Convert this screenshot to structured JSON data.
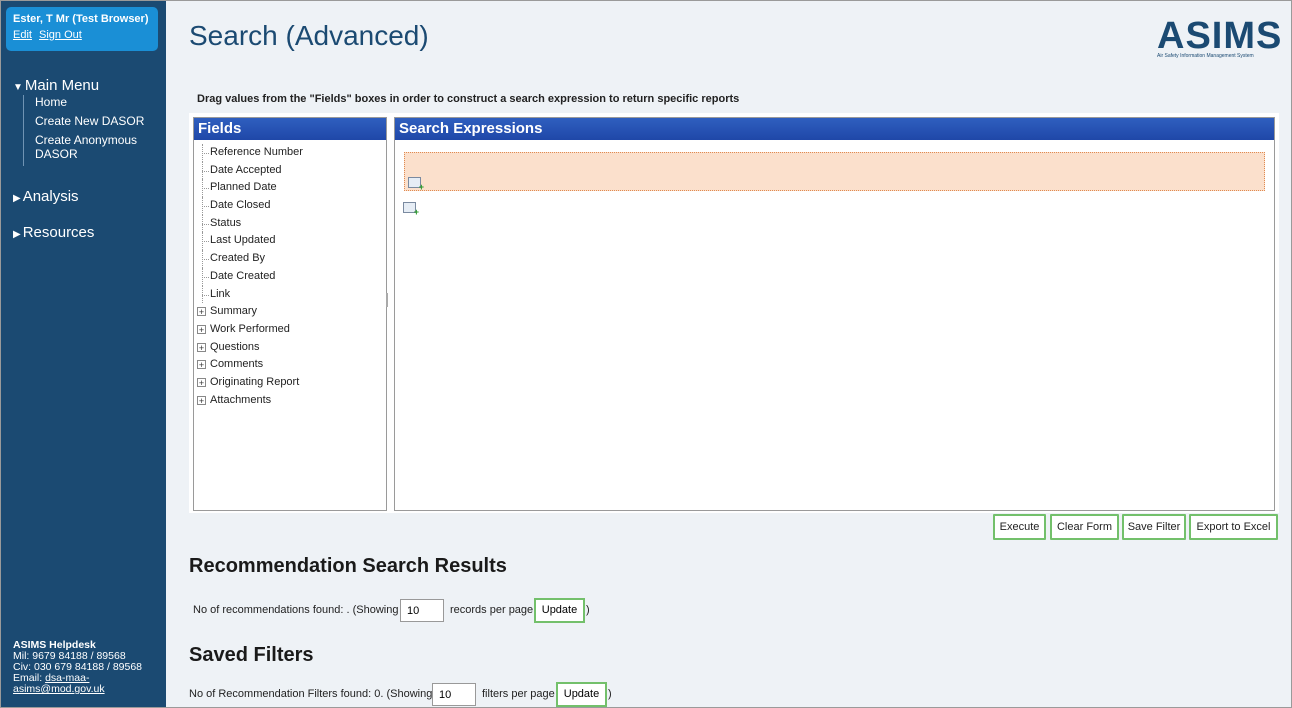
{
  "user": {
    "name": "Ester, T Mr (Test Browser)",
    "edit_label": "Edit",
    "signout_label": "Sign Out"
  },
  "menu": {
    "main_label": "Main Menu",
    "items": [
      {
        "label": "Home"
      },
      {
        "label": "Create New DASOR"
      },
      {
        "label": "Create Anonymous DASOR"
      }
    ],
    "analysis_label": "Analysis",
    "resources_label": "Resources"
  },
  "helpdesk": {
    "title": "ASIMS Helpdesk",
    "mil": "Mil: 9679 84188 / 89568",
    "civ": "Civ: 030 679 84188 / 89568",
    "email_prefix": "Email: ",
    "email": "dsa-maa-asims@mod.gov.uk"
  },
  "page": {
    "title": "Search (Advanced)"
  },
  "logo": {
    "text": "ASIMS",
    "sub": "Air Safety Information Management System"
  },
  "instruction": "Drag values from the \"Fields\" boxes in order to construct a search expression to return specific reports",
  "fields": {
    "header": "Fields",
    "leaf_items": [
      "Reference Number",
      "Date Accepted",
      "Planned Date",
      "Date Closed",
      "Status",
      "Last Updated",
      "Created By",
      "Date Created",
      "Link"
    ],
    "group_items": [
      "Summary",
      "Work Performed",
      "Questions",
      "Comments",
      "Originating Report",
      "Attachments"
    ]
  },
  "expressions": {
    "header": "Search Expressions"
  },
  "buttons": {
    "execute": "Execute",
    "clear": "Clear Form",
    "save": "Save Filter",
    "export": "Export to Excel"
  },
  "results": {
    "title": "Recommendation Search Results",
    "text_before": "No of recommendations found: . (Showing",
    "per_page_value": "10",
    "text_after": "records per page",
    "update_label": "Update",
    "close": ")"
  },
  "saved": {
    "title": "Saved Filters",
    "text_before": "No of Recommendation Filters found: 0. (Showing",
    "per_page_value": "10",
    "text_after": "filters per page",
    "update_label": "Update",
    "close": ")"
  }
}
